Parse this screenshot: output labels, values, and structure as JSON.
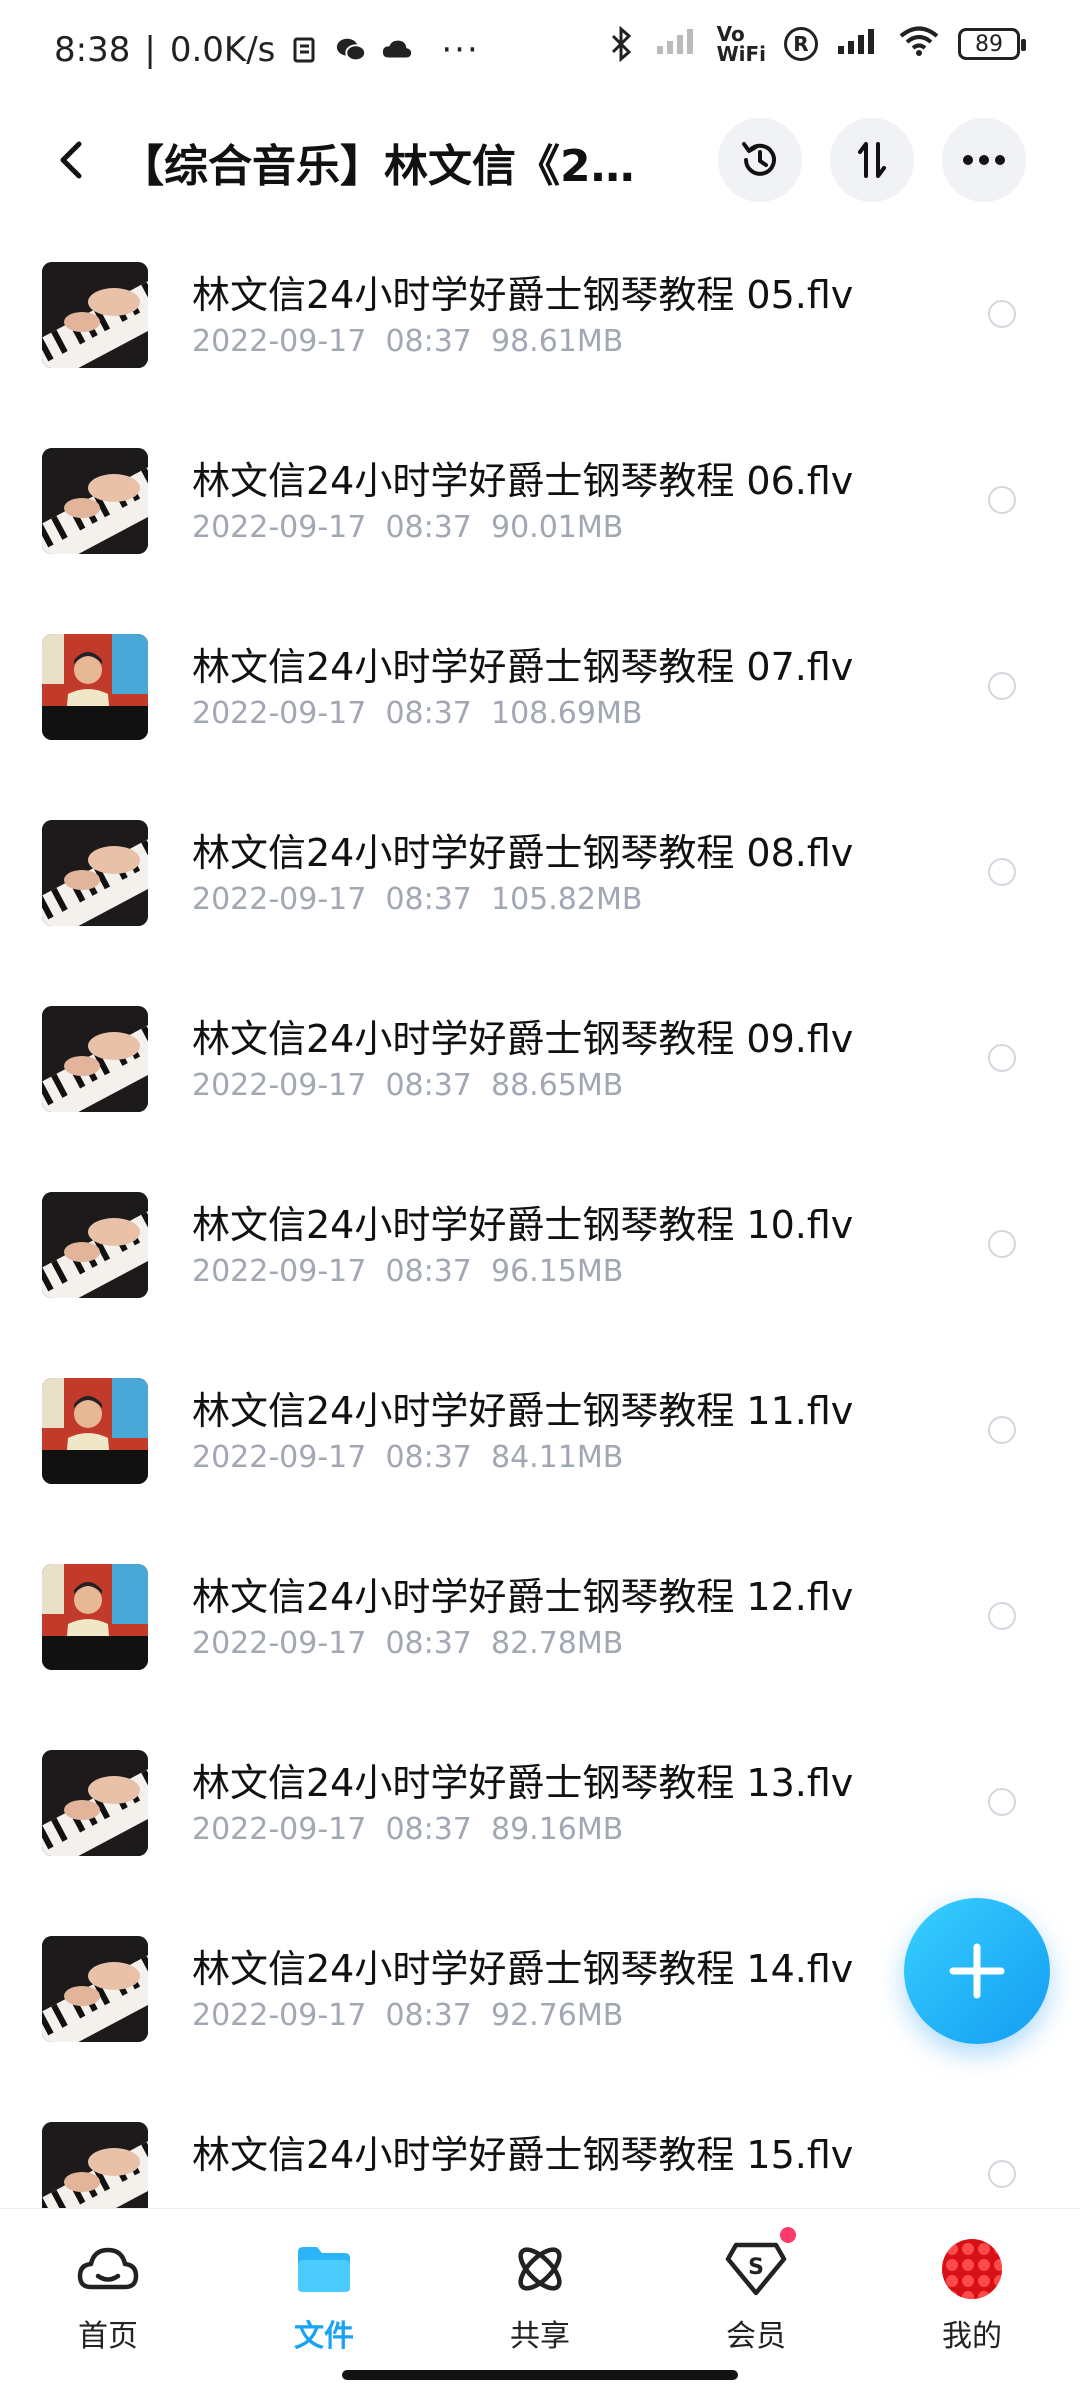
{
  "status_bar": {
    "time": "8:38",
    "net_speed": "0.0K/s",
    "more": "···",
    "battery": "89",
    "vowifi_top": "Vo",
    "vowifi_bottom": "WiFi",
    "registered": "R"
  },
  "header": {
    "title": "【综合音乐】林文信《2..."
  },
  "files": [
    {
      "name": "林文信24小时学好爵士钢琴教程 05.flv",
      "date": "2022-09-17",
      "time": "08:37",
      "size": "98.61MB",
      "thumb": "piano"
    },
    {
      "name": "林文信24小时学好爵士钢琴教程 06.flv",
      "date": "2022-09-17",
      "time": "08:37",
      "size": "90.01MB",
      "thumb": "piano"
    },
    {
      "name": "林文信24小时学好爵士钢琴教程 07.flv",
      "date": "2022-09-17",
      "time": "08:37",
      "size": "108.69MB",
      "thumb": "presenter"
    },
    {
      "name": "林文信24小时学好爵士钢琴教程 08.flv",
      "date": "2022-09-17",
      "time": "08:37",
      "size": "105.82MB",
      "thumb": "piano"
    },
    {
      "name": "林文信24小时学好爵士钢琴教程 09.flv",
      "date": "2022-09-17",
      "time": "08:37",
      "size": "88.65MB",
      "thumb": "piano"
    },
    {
      "name": "林文信24小时学好爵士钢琴教程 10.flv",
      "date": "2022-09-17",
      "time": "08:37",
      "size": "96.15MB",
      "thumb": "piano"
    },
    {
      "name": "林文信24小时学好爵士钢琴教程 11.flv",
      "date": "2022-09-17",
      "time": "08:37",
      "size": "84.11MB",
      "thumb": "presenter"
    },
    {
      "name": "林文信24小时学好爵士钢琴教程 12.flv",
      "date": "2022-09-17",
      "time": "08:37",
      "size": "82.78MB",
      "thumb": "presenter"
    },
    {
      "name": "林文信24小时学好爵士钢琴教程 13.flv",
      "date": "2022-09-17",
      "time": "08:37",
      "size": "89.16MB",
      "thumb": "piano"
    },
    {
      "name": "林文信24小时学好爵士钢琴教程 14.flv",
      "date": "2022-09-17",
      "time": "08:37",
      "size": "92.76MB",
      "thumb": "piano"
    },
    {
      "name": "林文信24小时学好爵士钢琴教程 15.flv",
      "date": "",
      "time": "",
      "size": "",
      "thumb": "piano"
    }
  ],
  "bottom_nav": [
    {
      "label": "首页",
      "icon": "cloud-icon",
      "active": false
    },
    {
      "label": "文件",
      "icon": "folder-icon",
      "active": true
    },
    {
      "label": "共享",
      "icon": "atom-icon",
      "active": false
    },
    {
      "label": "会员",
      "icon": "vip-diamond-icon",
      "active": false,
      "badge": true
    },
    {
      "label": "我的",
      "icon": "avatar",
      "active": false
    }
  ],
  "colors": {
    "accent": "#1aa3f5",
    "meta_text": "#a1a7b3",
    "badge": "#ff3b6b"
  }
}
